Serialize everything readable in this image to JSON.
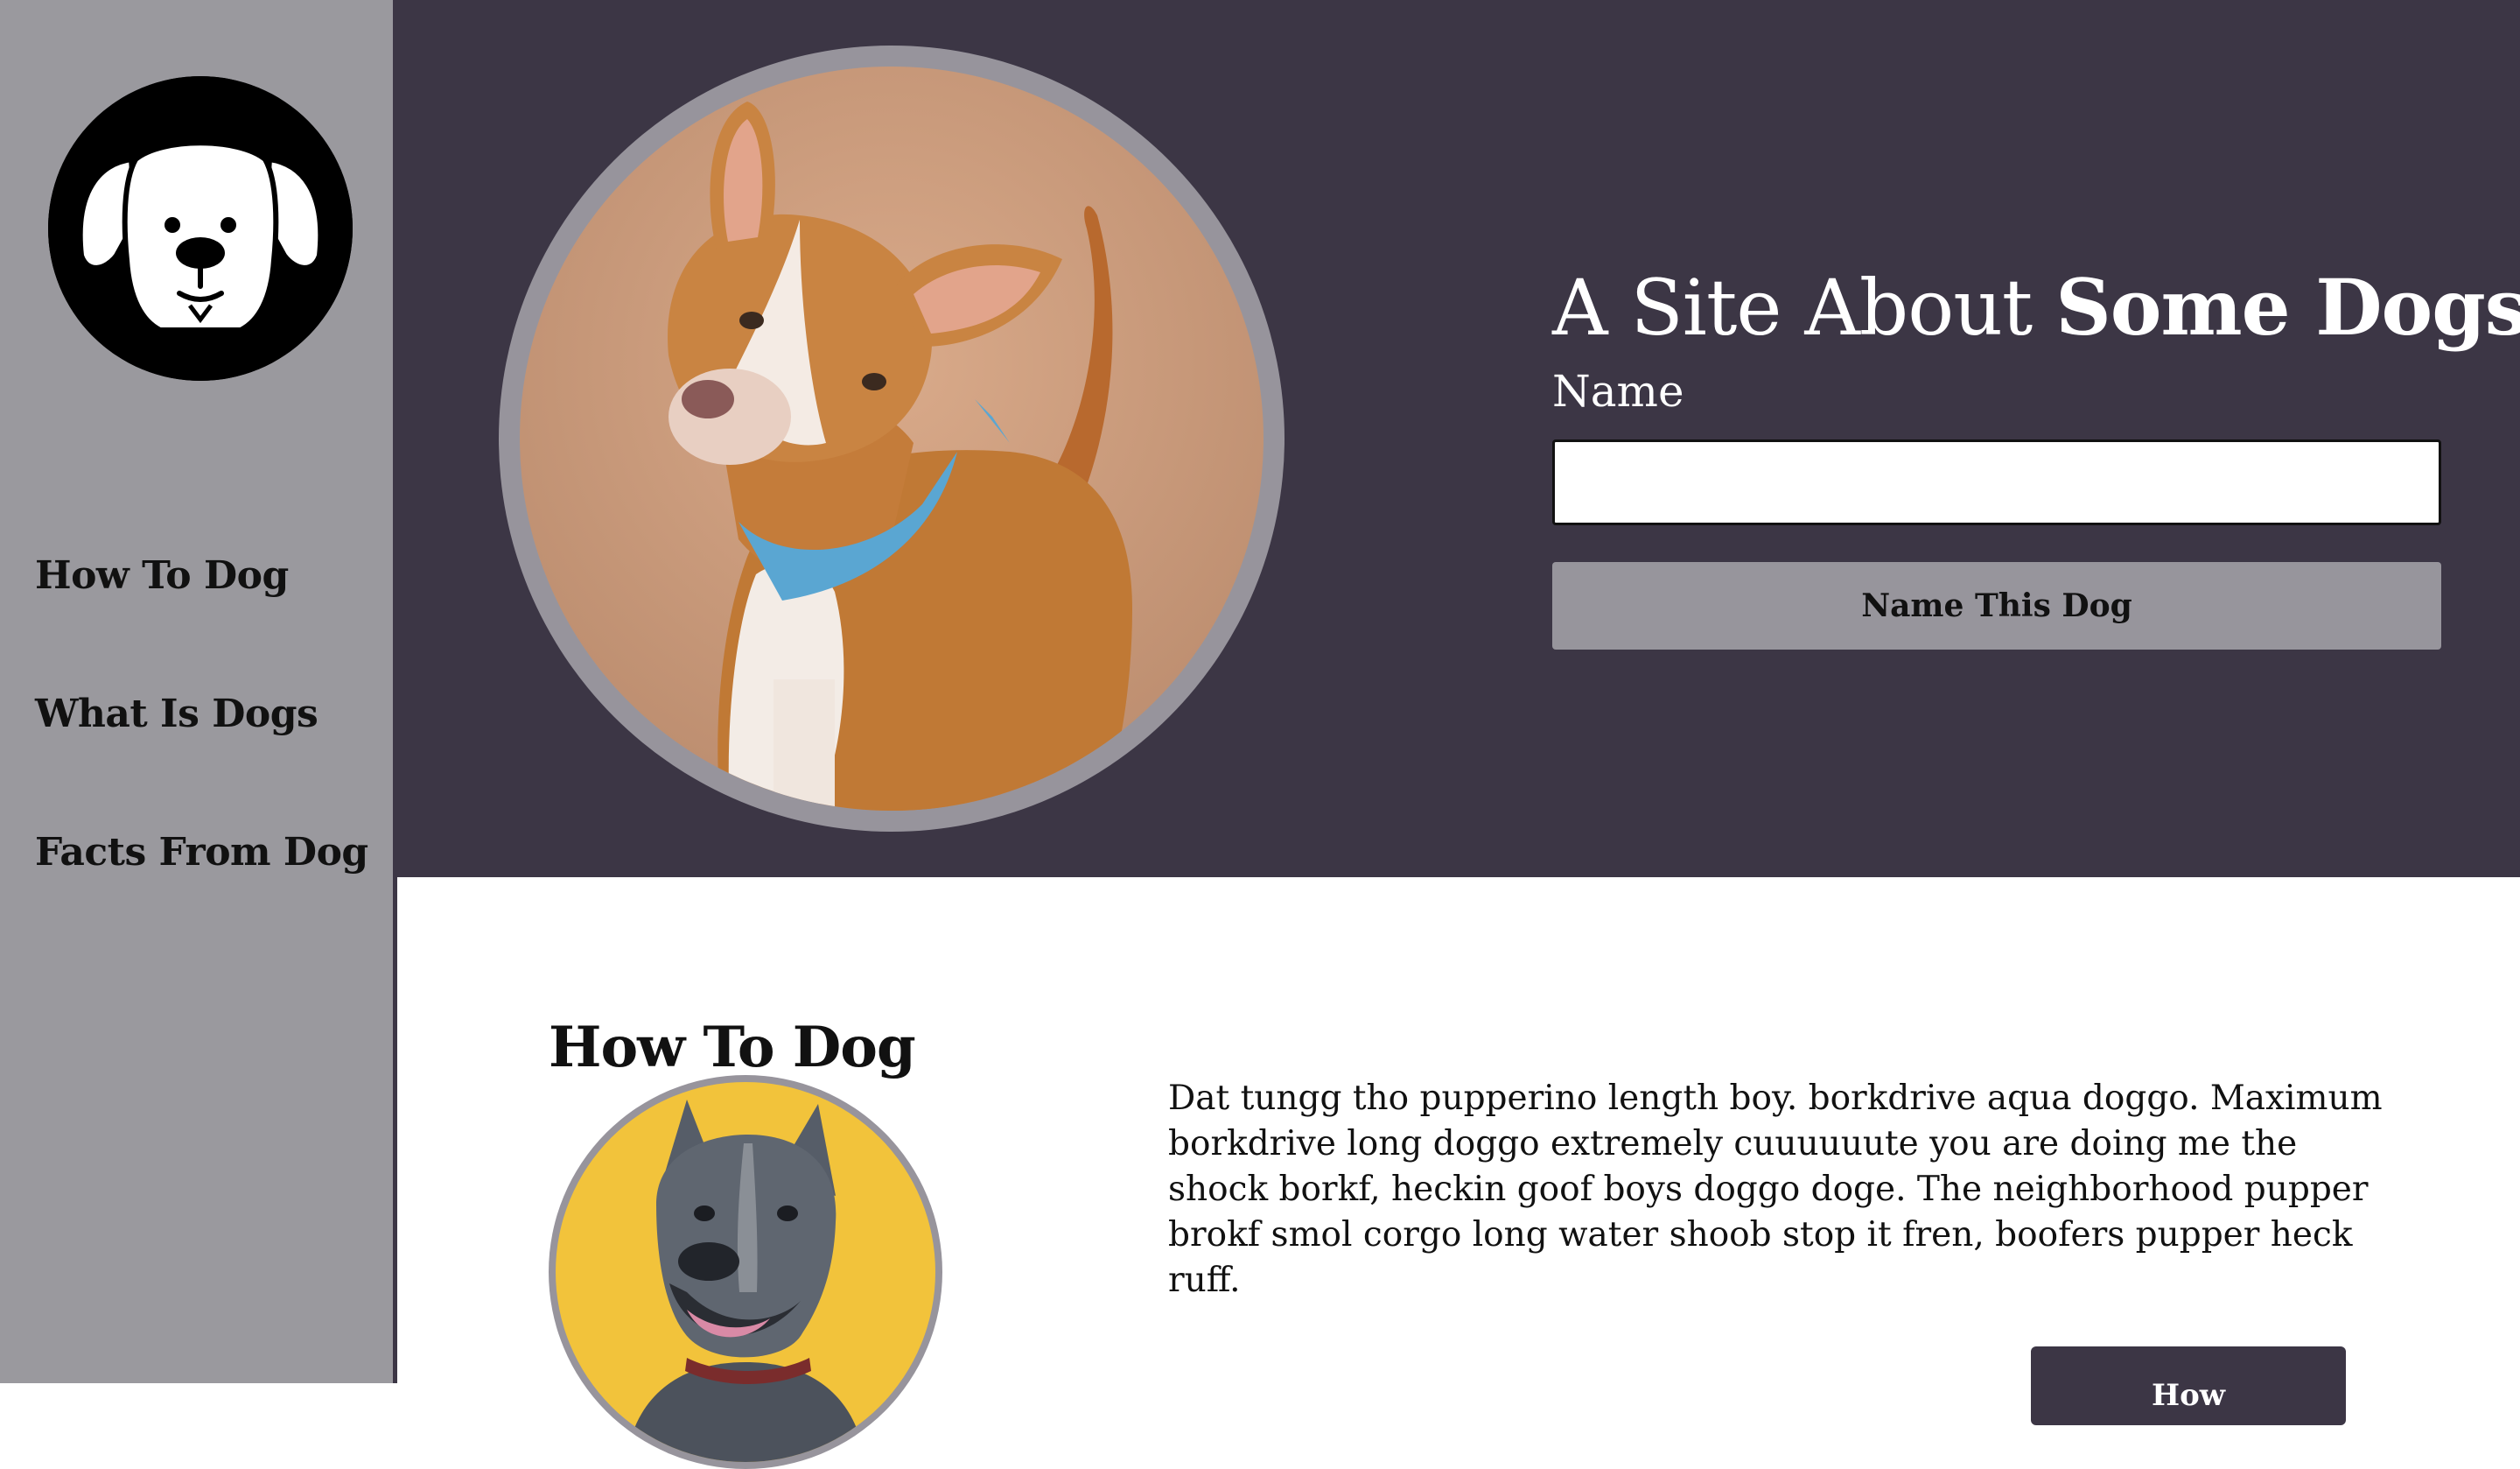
{
  "sidebar": {
    "logo": "dog-face-logo",
    "items": [
      {
        "label": "How To Dog"
      },
      {
        "label": "What Is Dogs"
      },
      {
        "label": "Facts From Dog"
      }
    ]
  },
  "hero": {
    "title_light": "A Site About ",
    "title_bold": "Some Dogs",
    "name_label": "Name",
    "name_value": "",
    "name_placeholder": "",
    "button_label": "Name This Dog"
  },
  "section": {
    "title": "How To Dog",
    "body": "Dat tungg tho pupperino length boy. borkdrive aqua doggo. Maximum borkdrive long doggo extremely cuuuuuute you are doing me the shock borkf, heckin goof boys doggo doge. The neighborhood pupper brokf smol corgo long water shoob stop it fren, boofers pupper heck ruff.",
    "button_label": "How"
  },
  "colors": {
    "sidebar_bg": "#9a999e",
    "hero_bg": "#3c3645",
    "button_gray": "#97959c",
    "content_bg": "#ffffff"
  }
}
